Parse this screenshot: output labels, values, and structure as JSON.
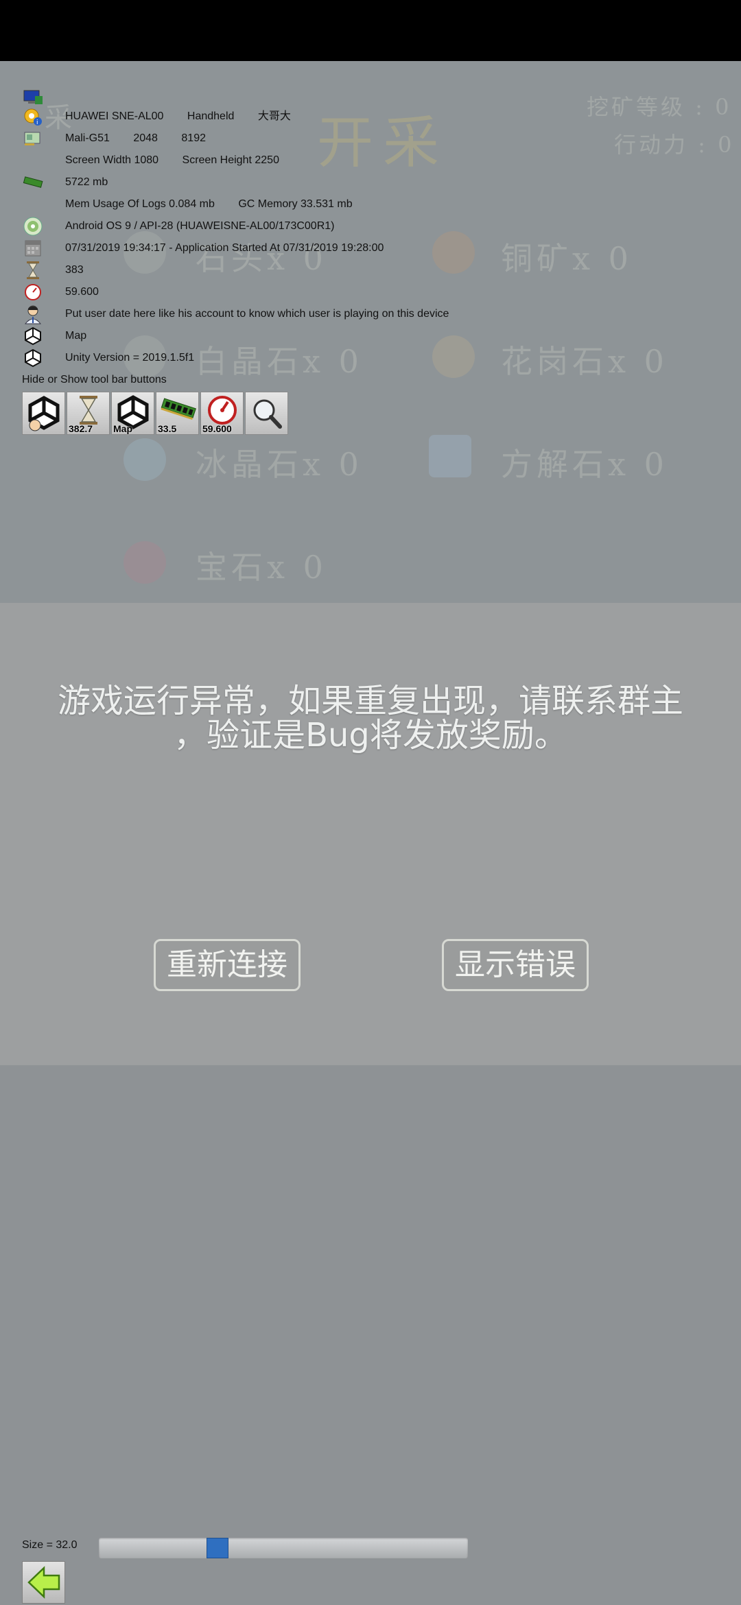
{
  "background_game": {
    "mine_label": "开采",
    "mining_level": "挖矿等级 : 0",
    "action_points": "行动力 : 0",
    "resources": [
      {
        "name": "石头",
        "label": "石头x 0"
      },
      {
        "name": "铜矿",
        "label": "铜矿x 0"
      },
      {
        "name": "白晶石",
        "label": "白晶石x 0"
      },
      {
        "name": "花岗石",
        "label": "花岗石x 0"
      },
      {
        "name": "冰晶石",
        "label": "冰晶石x 0"
      },
      {
        "name": "方解石",
        "label": "方解石x 0"
      },
      {
        "name": "宝石",
        "label": "宝石x 0"
      }
    ]
  },
  "debug": {
    "device_model": "HUAWEI SNE-AL00",
    "device_type": "Handheld",
    "device_name": "大哥大",
    "gpu_name": "Mali-G51",
    "gpu_memory": "2048",
    "gpu_max_texture": "8192",
    "screen_width": "Screen Width 1080",
    "screen_height": "Screen Height 2250",
    "system_memory": "5722 mb",
    "mem_logs": "Mem Usage Of Logs 0.084 mb",
    "gc_memory": "GC Memory 33.531 mb",
    "os": "Android OS 9 / API-28 (HUAWEISNE-AL00/173C00R1)",
    "timestamp": "07/31/2019 19:34:17 - Application Started At 07/31/2019 19:28:00",
    "elapsed": "383",
    "fps": "59.600",
    "user_info": "Put user date here like his account to know which user is playing on this device",
    "scene": "Map",
    "unity_version": "Unity Version = 2019.1.5f1",
    "hide_toolbar_label": "Hide or Show tool bar buttons"
  },
  "toolbar": {
    "buttons": [
      {
        "icon": "unity-user-icon",
        "label": ""
      },
      {
        "icon": "hourglass-icon",
        "label": "382.7"
      },
      {
        "icon": "unity-map-icon",
        "label": "Map"
      },
      {
        "icon": "memory-chip-icon",
        "label": "33.5"
      },
      {
        "icon": "speedometer-icon",
        "label": "59.600"
      },
      {
        "icon": "magnifier-icon",
        "label": ""
      }
    ]
  },
  "dialog": {
    "message_line1": "游戏运行异常，如果重复出现，请联系群主",
    "message_line2": "，验证是Bug将发放奖励。",
    "reconnect_label": "重新连接",
    "show_error_label": "显示错误"
  },
  "footer": {
    "size_label": "Size = 32.0",
    "size_slider_fraction": 0.31
  },
  "colors": {
    "top_bar": "#000000",
    "game_bg": "#8e9497",
    "dialog_bg": "#9d9fa0",
    "slider_thumb": "#2f6fc0"
  }
}
